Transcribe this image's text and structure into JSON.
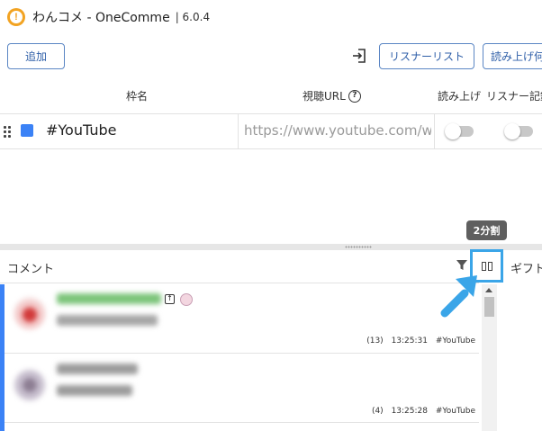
{
  "window": {
    "app_title": "わんコメ - OneComme",
    "version": "| 6.0.4"
  },
  "toolbar": {
    "add_label": "追加",
    "listener_list_label": "リスナーリスト",
    "read_aloud_label": "読み上げ何"
  },
  "table": {
    "headers": {
      "frame_name": "枠名",
      "watch_url": "視聴URL",
      "read_aloud": "読み上げ",
      "listener_record": "リスナー記録"
    },
    "rows": [
      {
        "name": "#YouTube",
        "color": "#3b82f6",
        "url_placeholder": "https://www.youtube.com/watch",
        "read_aloud_on": false,
        "listener_record_on": false
      }
    ]
  },
  "tooltip": {
    "text": "2分割"
  },
  "comment_panel": {
    "title": "コメント",
    "gift_label": "ギフト",
    "comments": [
      {
        "count": "(13)",
        "time": "13:25:31",
        "frame": "#YouTube"
      },
      {
        "count": "(4)",
        "time": "13:25:28",
        "frame": "#YouTube"
      }
    ]
  },
  "colors": {
    "accent_blue": "#3b82f6",
    "highlight_blue": "#3aa5e8",
    "button_border": "#5b86c4",
    "logo_orange": "#f2a322"
  }
}
